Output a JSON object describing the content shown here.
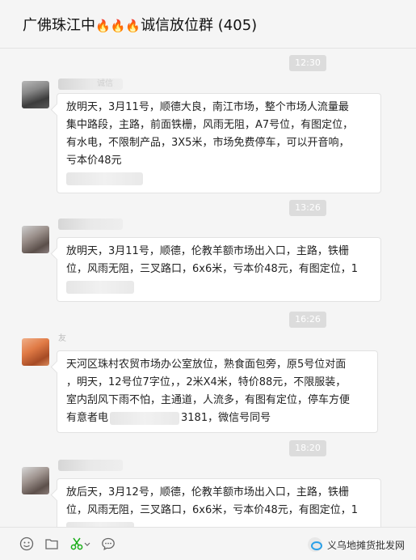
{
  "header": {
    "title_prefix": "广佛珠江中",
    "fire_icons": [
      "🔥",
      "🔥",
      "🔥"
    ],
    "title_suffix": "诚信放位群 (405)"
  },
  "messages": [
    {
      "time": "12:30",
      "sender": "诚信",
      "lines": [
        "放明天，3月11号，顺德大良，南江市场，整个市场人流量最",
        "集中路段，主路，前面铁栅，风雨无阻，A7号位，有图定位，",
        "有水电，不限制产品，3X5米，市场免费停车，可以开音响，",
        "亏本价48元"
      ]
    },
    {
      "time": "13:26",
      "sender": "",
      "lines": [
        "放明天，3月11号，顺德，伦教羊额市场出入口，主路，铁栅",
        "位，风雨无阻，三叉路口，6x6米，亏本价48元，有图定位，1"
      ]
    },
    {
      "time": "16:26",
      "sender": "友",
      "lines": [
        "天河区珠村农贸市场办公室放位，熟食面包旁，原5号位对面",
        "，明天，12号位7字位，，2米X4米，特价88元，不限服装，",
        "室内刮风下雨不怕，主通道，人流多，有图有定位，停车方便",
        "有意者电",
        "3181，微信号同号"
      ]
    },
    {
      "time": "18:20",
      "sender": "",
      "lines": [
        "放后天，3月12号，顺德，伦教羊额市场出入口，主路，铁栅",
        "位，风雨无阻，三叉路口，6x6米，亏本价48元，有图定位，1"
      ]
    }
  ],
  "toolbar": {
    "icons": [
      "emoji-icon",
      "folder-icon",
      "scissors-icon",
      "chat-bubble-icon"
    ],
    "brand": "义乌地摊货批发网"
  },
  "colors": {
    "background": "#f5f5f5",
    "bubble": "#ffffff",
    "timestamp": "#dcdcdc",
    "scissors": "#1aad19"
  }
}
